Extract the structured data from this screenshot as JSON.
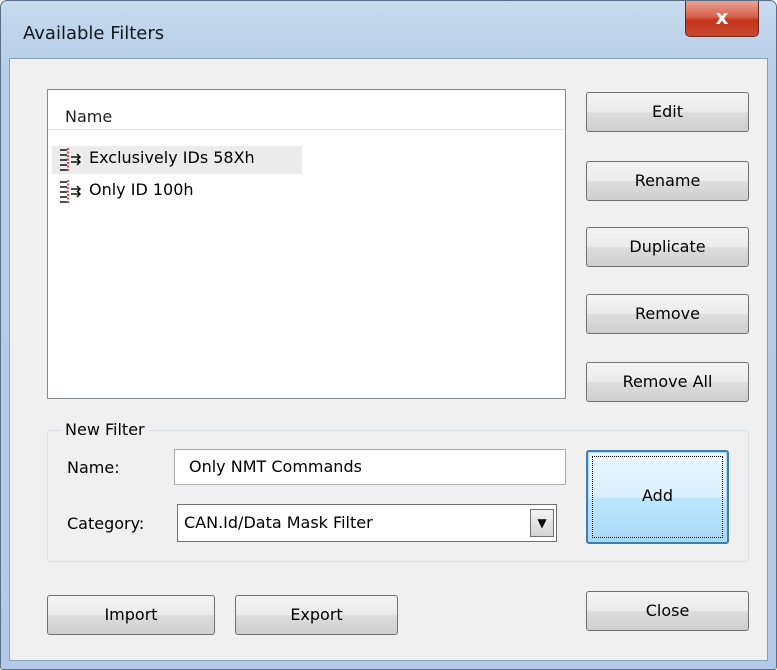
{
  "window": {
    "title": "Available Filters",
    "close_glyph": "x"
  },
  "filters_list": {
    "column_header": "Name",
    "items": [
      {
        "label": "Exclusively IDs 58Xh",
        "icon": "filter-icon"
      },
      {
        "label": "Only ID 100h",
        "icon": "filter-icon"
      }
    ]
  },
  "side_buttons": {
    "edit": "Edit",
    "rename": "Rename",
    "duplicate": "Duplicate",
    "remove": "Remove",
    "remove_all": "Remove All"
  },
  "new_filter": {
    "group_title": "New Filter",
    "name_label": "Name:",
    "name_value": "Only NMT Commands",
    "category_label": "Category:",
    "category_value": "CAN.Id/Data Mask Filter",
    "add_label": "Add"
  },
  "bottom_buttons": {
    "import": "Import",
    "export": "Export",
    "close": "Close"
  },
  "colors": {
    "frame": "#b9cfe8",
    "client_bg": "#f0f0f0",
    "close_button": "#c4341c",
    "focused_button": "#3c7fb1"
  }
}
